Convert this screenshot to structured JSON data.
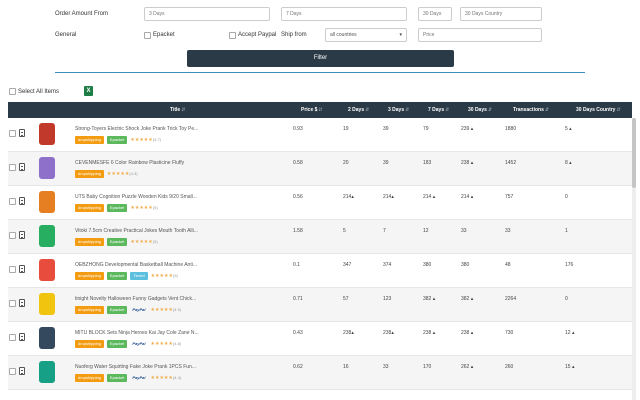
{
  "filters": {
    "order_amount_label": "Order Amount From",
    "order_3days_placeholder": "3 Days",
    "order_7days_placeholder": "7 Days",
    "order_30days_placeholder": "30 Days",
    "order_30days_country_placeholder": "30 Days Country",
    "general_label": "General",
    "epacket_label": "Epacket",
    "accept_paypal_label": "Accept Paypal",
    "ship_from_label": "Ship from",
    "ship_from_value": "all countries",
    "price_placeholder": "Price",
    "filter_button": "Filter"
  },
  "select_all_label": "Select All Items",
  "excel_icon_text": "X",
  "columns": {
    "title": "Title",
    "price": "Price $",
    "d2": "2 Days",
    "d3": "3 Days",
    "d7": "7 Days",
    "d30": "30 Days",
    "transactions": "Transactions",
    "d30country": "30 Days Country"
  },
  "sort_icon": "⇵",
  "star_glyphs": "★★★★★",
  "tag_labels": {
    "dropshipping": "dropshipping",
    "epacket": "Epacket",
    "tiered": "Tiered",
    "paypal": "PayPal"
  },
  "colors": {
    "header_bg": "#2b3a47",
    "dropshipping_tag": "#f39c12",
    "epacket_tag": "#5cb85c",
    "tiered_tag": "#5bc0de",
    "divider": "#3c8dbc",
    "excel": "#1e7e45"
  },
  "rows": [
    {
      "title": "Strong-Toyers Electric Shock Joke Prank Trick Toy Pe...",
      "tags": [
        "dropshipping",
        "epacket"
      ],
      "paypal": false,
      "rating": "(4.7)",
      "price": "0.93",
      "d2": "19",
      "d3": "39",
      "d7": "79",
      "d30": "239 ▴",
      "transactions": "1880",
      "d30country": "5 ▴",
      "thumb": "#c0392b"
    },
    {
      "title": "CEVENMESFE 6 Color Rainbow Plasticine Fluffy",
      "tags": [
        "dropshipping"
      ],
      "paypal": false,
      "rating": "(4.3)",
      "price": "0.58",
      "d2": "20",
      "d3": "39",
      "d7": "183",
      "d30": "238 ▴",
      "transactions": "1452",
      "d30country": "8 ▴",
      "thumb": "#8e6fc9"
    },
    {
      "title": "UTS Baby Cognition Puzzle Wooden Kids 9/20 Small...",
      "tags": [
        "dropshipping",
        "epacket"
      ],
      "paypal": false,
      "rating": "(5)",
      "price": "0.56",
      "d2": "214▴",
      "d3": "214▴",
      "d7": "214 ▴",
      "d30": "214 ▴",
      "transactions": "757",
      "d30country": "0",
      "thumb": "#e67e22"
    },
    {
      "title": "Vitoki 7.5cm Creative Practical Jokes Mouth Tooth Alli...",
      "tags": [
        "dropshipping",
        "epacket"
      ],
      "paypal": false,
      "rating": "(5)",
      "price": "1.58",
      "d2": "5",
      "d3": "7",
      "d7": "12",
      "d30": "33",
      "transactions": "33",
      "d30country": "1",
      "thumb": "#27ae60"
    },
    {
      "title": "OEBZHONG Developmental Basketball Machine Anti...",
      "tags": [
        "dropshipping",
        "epacket",
        "tiered"
      ],
      "paypal": false,
      "rating": "(5)",
      "price": "0.1",
      "d2": "347",
      "d3": "374",
      "d7": "380",
      "d30": "380",
      "transactions": "48",
      "d30country": "176",
      "thumb": "#e74c3c"
    },
    {
      "title": "tinight Novelty Halloween Funny Gadgets Vent Chick...",
      "tags": [
        "dropshipping",
        "epacket"
      ],
      "paypal": true,
      "rating": "(4.9)",
      "price": "0.71",
      "d2": "57",
      "d3": "123",
      "d7": "382 ▴",
      "d30": "382 ▴",
      "transactions": "2264",
      "d30country": "0",
      "thumb": "#f1c40f"
    },
    {
      "title": "MITU BLOCK Sets Ninja Heroes Kai Jay Cole Zane N...",
      "tags": [
        "dropshipping",
        "epacket"
      ],
      "paypal": true,
      "rating": "(4.8)",
      "price": "0.43",
      "d2": "238▴",
      "d3": "238▴",
      "d7": "238 ▴",
      "d30": "238 ▴",
      "transactions": "730",
      "d30country": "12 ▴",
      "thumb": "#34495e"
    },
    {
      "title": "Nuoferg Water Squirting Fake Joke Prank 1PCS Fun...",
      "tags": [
        "dropshipping",
        "epacket"
      ],
      "paypal": true,
      "rating": "(4.4)",
      "price": "0.62",
      "d2": "16",
      "d3": "33",
      "d7": "170",
      "d30": "262 ▴",
      "transactions": "260",
      "d30country": "15 ▴",
      "thumb": "#16a085"
    }
  ]
}
